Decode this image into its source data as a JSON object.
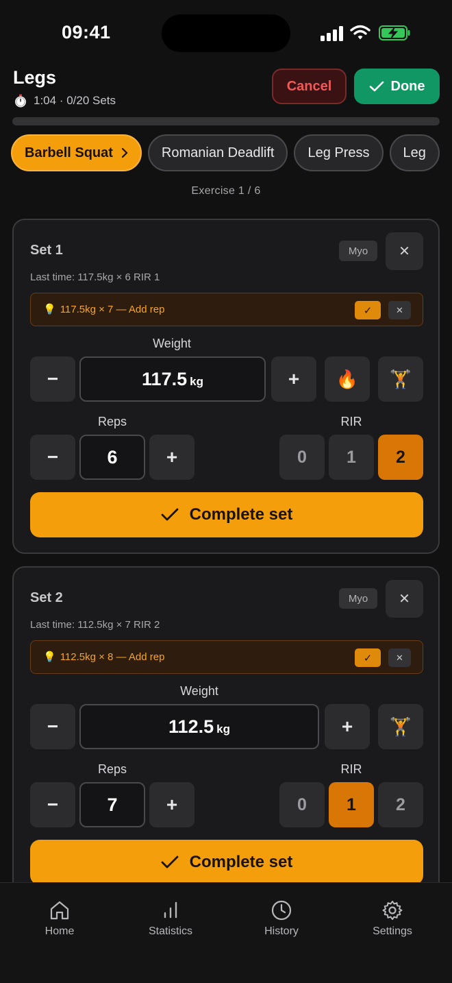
{
  "status": {
    "time": "09:41"
  },
  "header": {
    "title": "Legs",
    "elapsed": "1:04",
    "sets_summary": "0/20 Sets",
    "cancel_label": "Cancel",
    "done_label": "Done",
    "progress_fraction": 0
  },
  "tabs": [
    {
      "label": "Barbell Squat",
      "active": true
    },
    {
      "label": "Romanian Deadlift",
      "active": false
    },
    {
      "label": "Leg Press",
      "active": false
    },
    {
      "label": "Leg",
      "active": false
    }
  ],
  "exercise_counter": "Exercise 1 / 6",
  "sets": [
    {
      "title": "Set 1",
      "badge": "Myo",
      "last_time": "Last time: 117.5kg × 6 RIR 1",
      "suggestion": "117.5kg × 7 — Add rep",
      "weight_label": "Weight",
      "weight": "117.5",
      "unit": "kg",
      "reps_label": "Reps",
      "reps": "6",
      "rir_label": "RIR",
      "rir_options": [
        "0",
        "1",
        "2"
      ],
      "rir_selected": "2",
      "complete_label": "Complete set"
    },
    {
      "title": "Set 2",
      "badge": "Myo",
      "last_time": "Last time: 112.5kg × 7 RIR 2",
      "suggestion": "112.5kg × 8 — Add rep",
      "weight_label": "Weight",
      "weight": "112.5",
      "unit": "kg",
      "reps_label": "Reps",
      "reps": "7",
      "rir_label": "RIR",
      "rir_options": [
        "0",
        "1",
        "2"
      ],
      "rir_selected": "1",
      "complete_label": "Complete set"
    }
  ],
  "nav": [
    {
      "label": "Home",
      "icon": "home-icon"
    },
    {
      "label": "Statistics",
      "icon": "bar-chart-icon"
    },
    {
      "label": "History",
      "icon": "clock-icon"
    },
    {
      "label": "Settings",
      "icon": "gear-icon"
    }
  ],
  "colors": {
    "accent": "#f59e0b",
    "done": "#109764",
    "cancel": "#f05a5a"
  }
}
